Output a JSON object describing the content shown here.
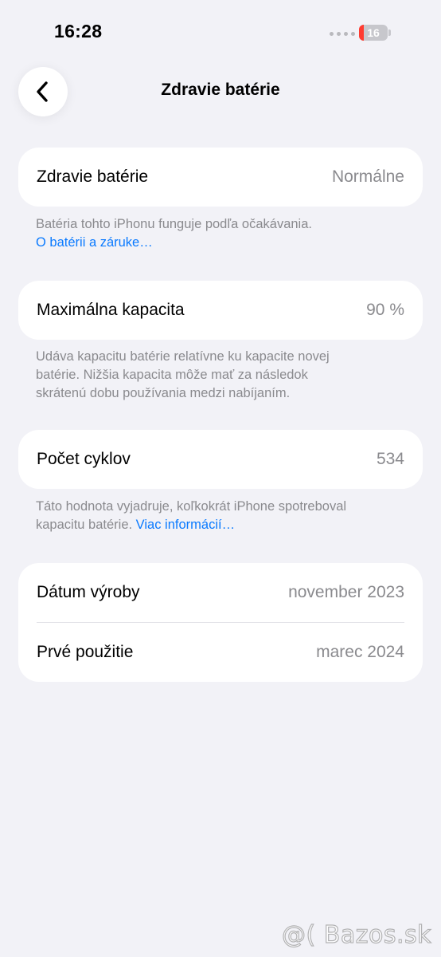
{
  "status_bar": {
    "time": "16:28",
    "battery_level": "16",
    "battery_fraction": 0.16,
    "battery_color": "#ff3b30"
  },
  "nav": {
    "back_icon": "chevron-left-icon",
    "title": "Zdravie batérie"
  },
  "battery_health": {
    "label": "Zdravie batérie",
    "value": "Normálne",
    "note": "Batéria tohto iPhonu funguje podľa očakávania.",
    "link": "O batérii a záruke…"
  },
  "max_capacity": {
    "label": "Maximálna kapacita",
    "value": "90 %",
    "note_line1": "Udáva kapacitu batérie relatívne ku kapacite novej",
    "note_line2": "batérie. Nižšia kapacita môže mať za následok",
    "note_line3": "skrátenú dobu používania medzi nabíjaním."
  },
  "cycle_count": {
    "label": "Počet cyklov",
    "value": "534",
    "note_line1": "Táto hodnota vyjadruje, koľkokrát iPhone spotreboval",
    "note_line2": "kapacitu batérie.",
    "link": "Viac informácií…"
  },
  "dates": {
    "manufacture_label": "Dátum výroby",
    "manufacture_value": "november 2023",
    "first_use_label": "Prvé použitie",
    "first_use_value": "marec 2024"
  },
  "watermark": "@( Bazos.sk",
  "colors": {
    "background": "#f2f2f7",
    "card": "#ffffff",
    "secondary_text": "#8a8a8e",
    "link": "#0a7aff"
  }
}
